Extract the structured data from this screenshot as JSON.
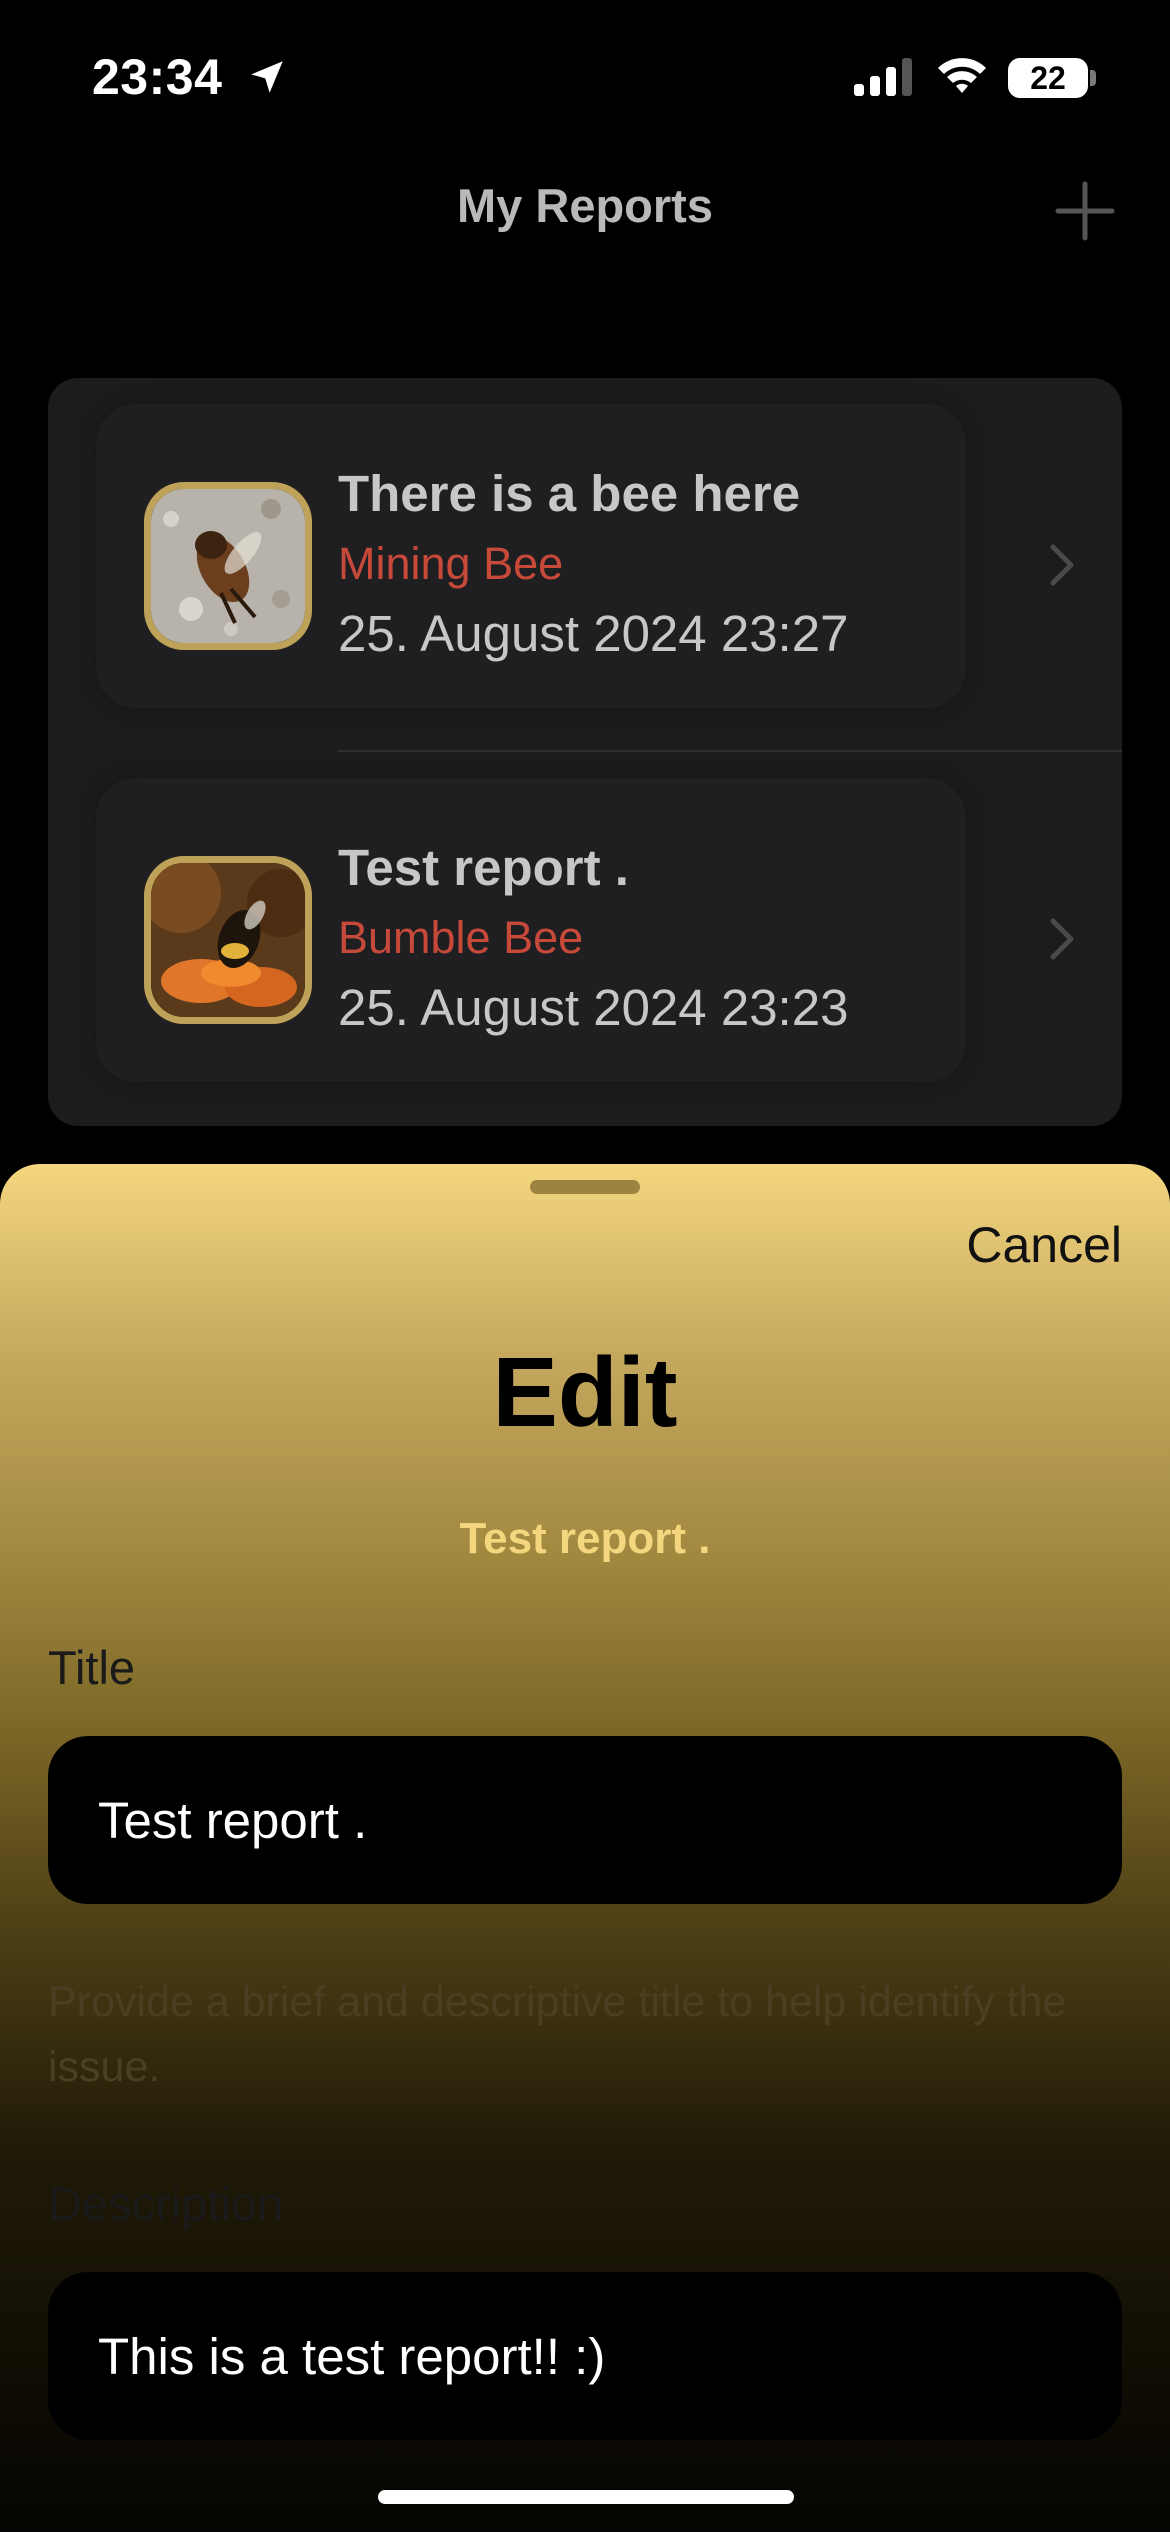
{
  "status_bar": {
    "time": "23:34",
    "battery": "22"
  },
  "nav": {
    "title": "My Reports"
  },
  "reports": [
    {
      "title": "There is a bee here",
      "species": "Mining Bee",
      "date": "25. August 2024  23:27"
    },
    {
      "title": "Test report .",
      "species": "Bumble Bee",
      "date": "25. August 2024  23:23"
    }
  ],
  "sheet": {
    "cancel_label": "Cancel",
    "title": "Edit",
    "subtitle": "Test report .",
    "title_label": "Title",
    "title_value": "Test report .",
    "title_helper": "Provide a brief and descriptive title to help identify the issue.",
    "description_label": "Description",
    "description_value": "This is a test  report!! :)"
  },
  "colors": {
    "accent": "#f4d67e",
    "species_red": "#c7493a",
    "thumb_border": "#bfa25a"
  }
}
